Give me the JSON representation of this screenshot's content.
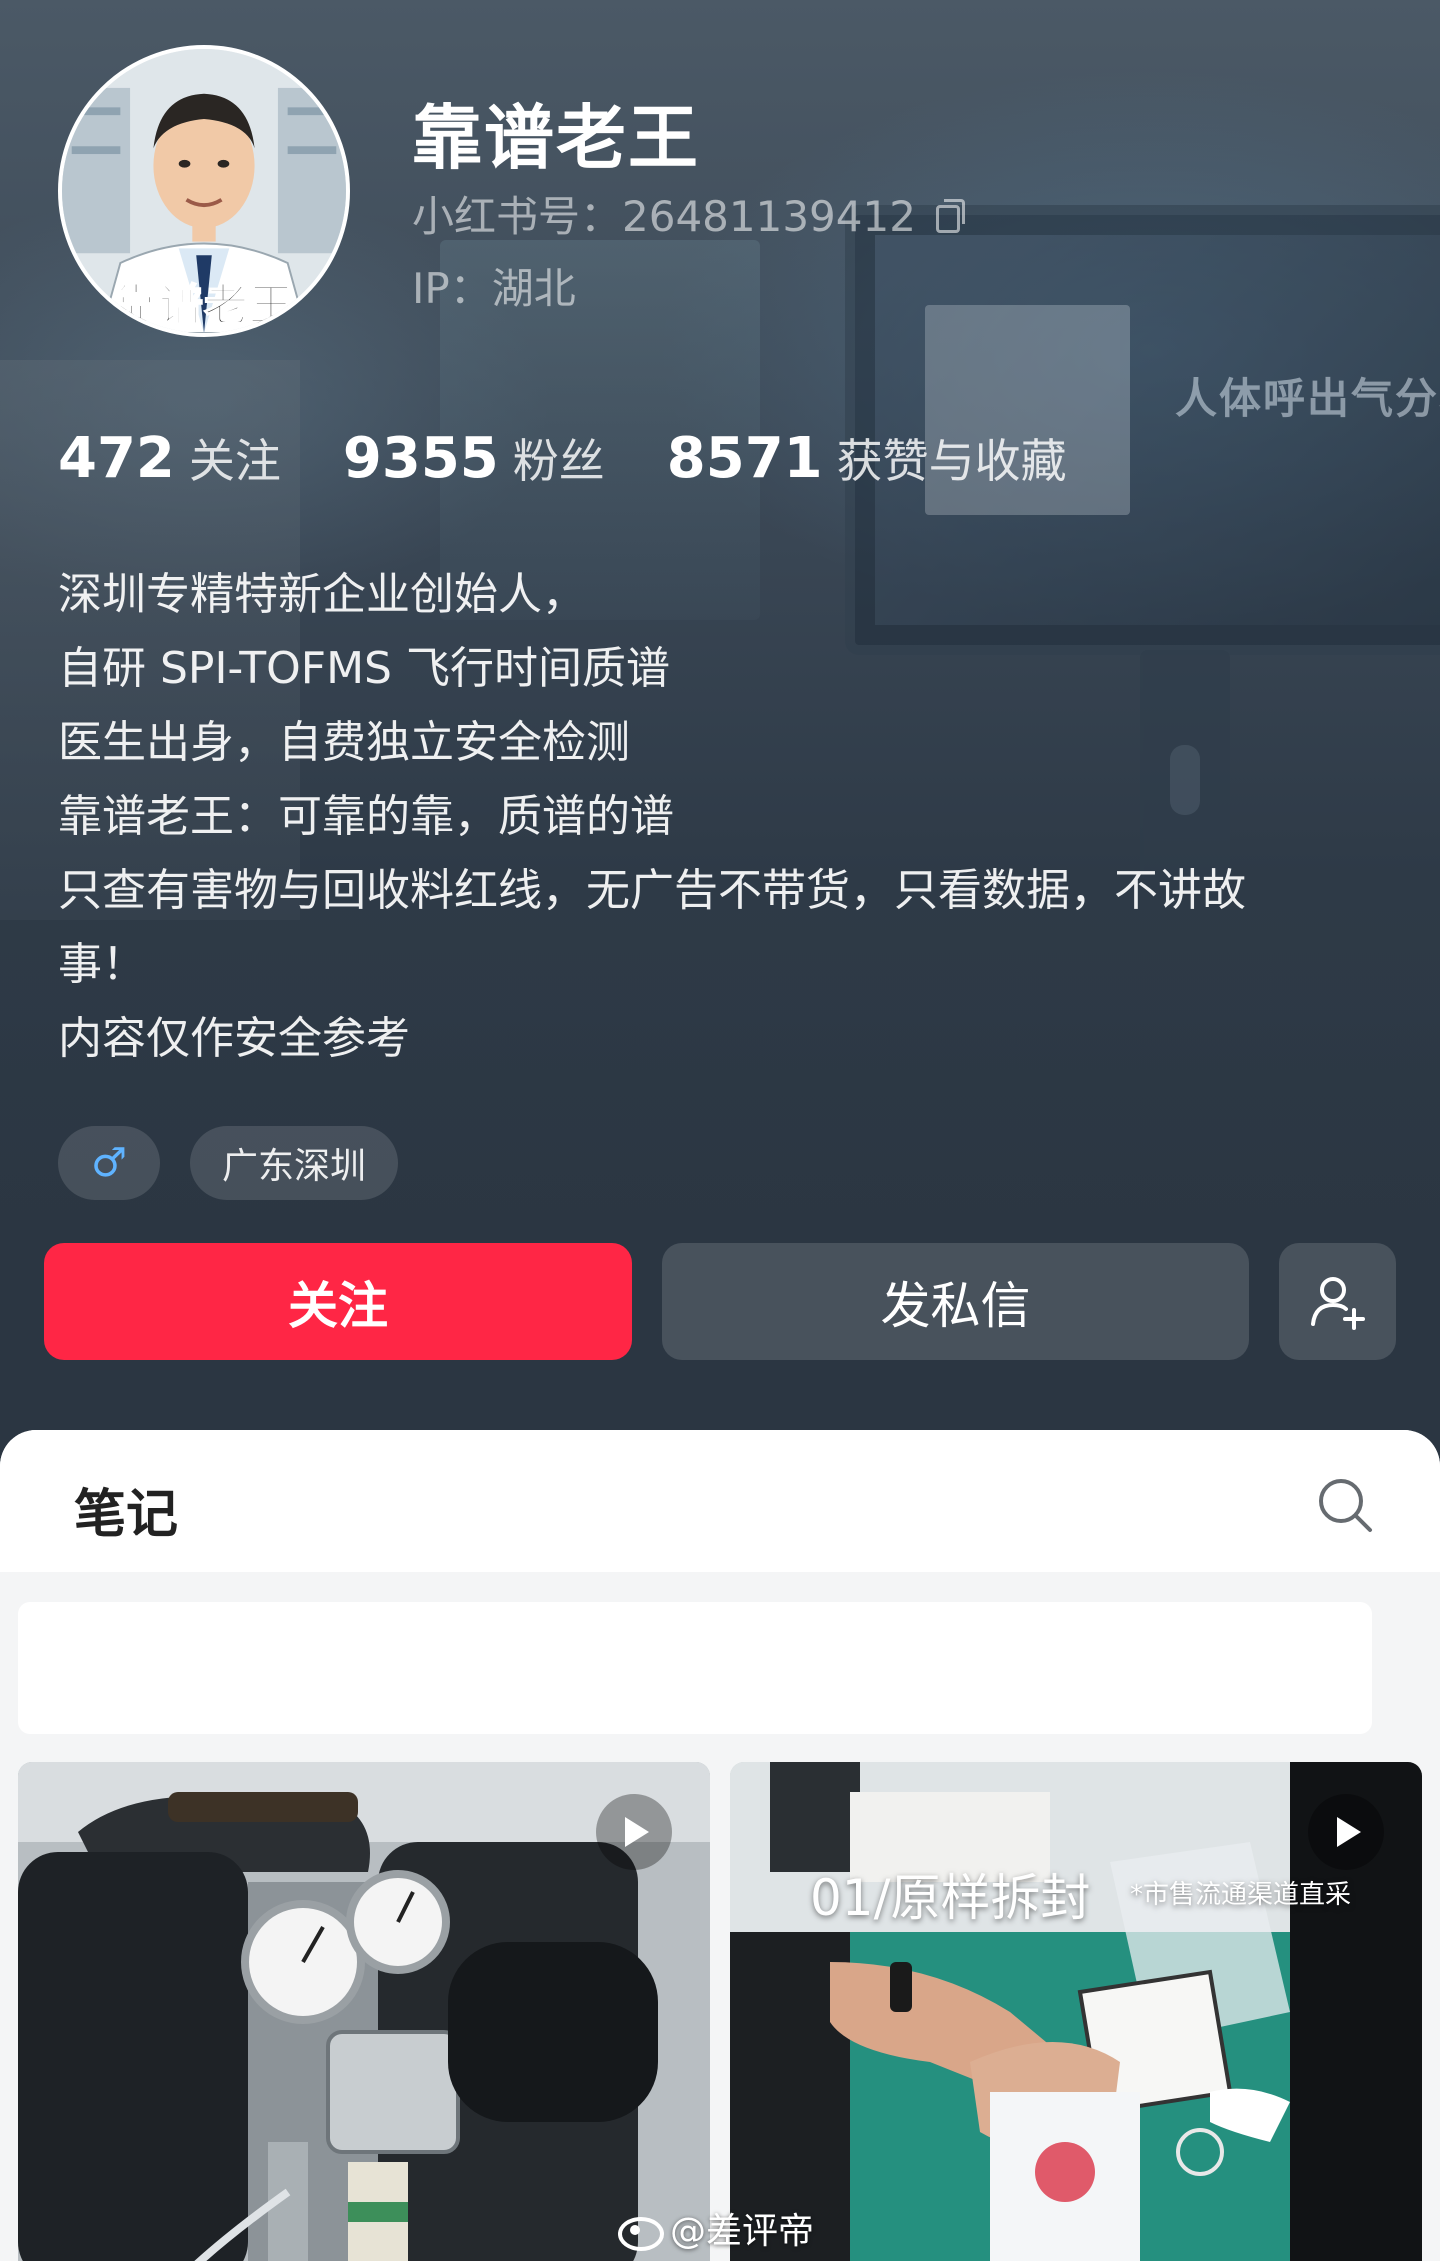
{
  "profile": {
    "name": "靠谱老王",
    "avatar_caption": "靠谱老王",
    "red_id": "小红书号：26481139412",
    "ip": "IP：湖北"
  },
  "background": {
    "screen_title": "人体呼出气分析"
  },
  "stats": [
    {
      "value": "472",
      "label": "关注"
    },
    {
      "value": "9355",
      "label": "粉丝"
    },
    {
      "value": "8571",
      "label": "获赞与收藏"
    }
  ],
  "bio": [
    "深圳专精特新企业创始人，",
    "自研 SPI-TOFMS 飞行时间质谱",
    "医生出身，自费独立安全检测",
    "靠谱老王：可靠的靠，质谱的谱",
    "只查有害物与回收料红线，无广告不带货，只看数据，不讲故",
    "事！",
    "内容仅作安全参考"
  ],
  "tags": {
    "gender_symbol": "♂",
    "location": "广东深圳"
  },
  "actions": {
    "follow": "关注",
    "message": "发私信",
    "add_user_icon": "add-user-icon"
  },
  "notes": {
    "tab_title": "笔记",
    "search_icon": "search-icon",
    "items": [
      {
        "overlay_title": "",
        "overlay_sub": ""
      },
      {
        "overlay_title": "01/原样拆封",
        "overlay_sub": "*市售流通渠道直采"
      }
    ]
  },
  "watermark": "@差评帝",
  "colors": {
    "follow_button": "#ff2645",
    "gender_tag": "#5fb3ff",
    "header_bg": "#2c3744"
  }
}
